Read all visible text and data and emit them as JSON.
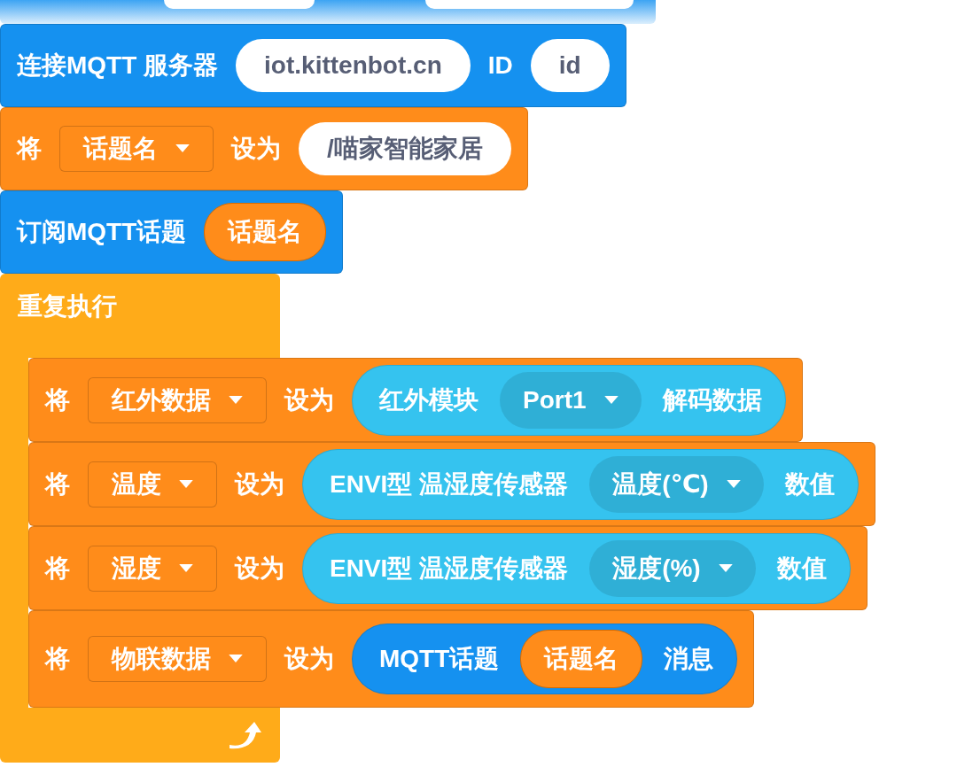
{
  "blocks": [
    {
      "kind": "command",
      "color": "#1591f0",
      "parts": [
        {
          "kind": "text",
          "text": "连接MQTT 服务器"
        },
        {
          "kind": "input",
          "text": "iot.kittenbot.cn"
        },
        {
          "kind": "text",
          "text": "ID"
        },
        {
          "kind": "input",
          "text": "id"
        }
      ]
    },
    {
      "kind": "command",
      "color": "#ff8c1a",
      "parts": [
        {
          "kind": "text",
          "text": "将"
        },
        {
          "kind": "dropdown",
          "text": "话题名"
        },
        {
          "kind": "text",
          "text": "设为"
        },
        {
          "kind": "input",
          "text": "/喵家智能家居"
        }
      ]
    },
    {
      "kind": "command",
      "color": "#1591f0",
      "parts": [
        {
          "kind": "text",
          "text": "订阅MQTT话题"
        },
        {
          "kind": "variable",
          "text": "话题名"
        }
      ]
    },
    {
      "kind": "loop",
      "color": "#ffab19",
      "label": "重复执行",
      "children": [
        {
          "kind": "command",
          "color": "#ff8c1a",
          "parts": [
            {
              "kind": "text",
              "text": "将"
            },
            {
              "kind": "dropdown",
              "text": "红外数据"
            },
            {
              "kind": "text",
              "text": "设为"
            },
            {
              "kind": "reporter",
              "color": "#35c3ef",
              "parts": [
                {
                  "kind": "text",
                  "text": "红外模块"
                },
                {
                  "kind": "dropdown",
                  "text": "Port1"
                },
                {
                  "kind": "text",
                  "text": "解码数据"
                }
              ]
            }
          ]
        },
        {
          "kind": "command",
          "color": "#ff8c1a",
          "parts": [
            {
              "kind": "text",
              "text": "将"
            },
            {
              "kind": "dropdown",
              "text": "温度"
            },
            {
              "kind": "text",
              "text": "设为"
            },
            {
              "kind": "reporter",
              "color": "#35c3ef",
              "parts": [
                {
                  "kind": "text",
                  "text": "ENVI型 温湿度传感器"
                },
                {
                  "kind": "dropdown",
                  "text": "温度(℃)"
                },
                {
                  "kind": "text",
                  "text": "数值"
                }
              ]
            }
          ]
        },
        {
          "kind": "command",
          "color": "#ff8c1a",
          "parts": [
            {
              "kind": "text",
              "text": "将"
            },
            {
              "kind": "dropdown",
              "text": "湿度"
            },
            {
              "kind": "text",
              "text": "设为"
            },
            {
              "kind": "reporter",
              "color": "#35c3ef",
              "parts": [
                {
                  "kind": "text",
                  "text": "ENVI型 温湿度传感器"
                },
                {
                  "kind": "dropdown",
                  "text": "湿度(%)"
                },
                {
                  "kind": "text",
                  "text": "数值"
                }
              ]
            }
          ]
        },
        {
          "kind": "command",
          "color": "#ff8c1a",
          "parts": [
            {
              "kind": "text",
              "text": "将"
            },
            {
              "kind": "dropdown",
              "text": "物联数据"
            },
            {
              "kind": "text",
              "text": "设为"
            },
            {
              "kind": "reporter",
              "color": "#1591f0",
              "parts": [
                {
                  "kind": "text",
                  "text": "MQTT话题"
                },
                {
                  "kind": "variable",
                  "text": "话题名"
                },
                {
                  "kind": "text",
                  "text": "消息"
                }
              ]
            }
          ]
        }
      ]
    }
  ]
}
